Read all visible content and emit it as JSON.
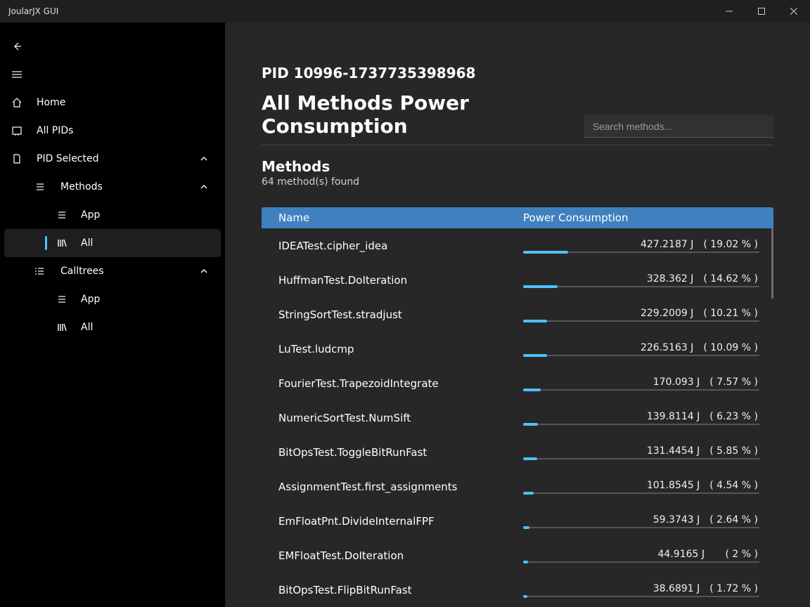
{
  "window": {
    "title": "JoularJX GUI"
  },
  "sidebar": {
    "home": "Home",
    "all_pids": "All PIDs",
    "pid_selected": "PID Selected",
    "methods": "Methods",
    "methods_app": "App",
    "methods_all": "All",
    "calltrees": "Calltrees",
    "calltrees_app": "App",
    "calltrees_all": "All"
  },
  "main": {
    "pid_title": "PID 10996-1737735398968",
    "page_title": "All Methods Power Consumption",
    "search_placeholder": "Search methods...",
    "methods_header": "Methods",
    "methods_found": "64 method(s) found",
    "col_name": "Name",
    "col_power": "Power Consumption"
  },
  "rows": [
    {
      "name": "IDEATest.cipher_idea",
      "joules": "427.2187 J",
      "pct": "( 19.02 % )",
      "bar": 19.02
    },
    {
      "name": "HuffmanTest.DoIteration",
      "joules": "328.362 J",
      "pct": "( 14.62 % )",
      "bar": 14.62
    },
    {
      "name": "StringSortTest.stradjust",
      "joules": "229.2009 J",
      "pct": "( 10.21 % )",
      "bar": 10.21
    },
    {
      "name": "LuTest.ludcmp",
      "joules": "226.5163 J",
      "pct": "( 10.09 % )",
      "bar": 10.09
    },
    {
      "name": "FourierTest.TrapezoidIntegrate",
      "joules": "170.093 J",
      "pct": "( 7.57 % )",
      "bar": 7.57
    },
    {
      "name": "NumericSortTest.NumSift",
      "joules": "139.8114 J",
      "pct": "( 6.23 % )",
      "bar": 6.23
    },
    {
      "name": "BitOpsTest.ToggleBitRunFast",
      "joules": "131.4454 J",
      "pct": "( 5.85 % )",
      "bar": 5.85
    },
    {
      "name": "AssignmentTest.first_assignments",
      "joules": "101.8545 J",
      "pct": "( 4.54 % )",
      "bar": 4.54
    },
    {
      "name": "EmFloatPnt.DivideInternalFPF",
      "joules": "59.3743 J",
      "pct": "( 2.64 % )",
      "bar": 2.64
    },
    {
      "name": "EMFloatTest.DoIteration",
      "joules": "44.9165 J",
      "pct": "( 2 % )",
      "bar": 2.0
    },
    {
      "name": "BitOpsTest.FlipBitRunFast",
      "joules": "38.6891 J",
      "pct": "( 1.72 % )",
      "bar": 1.72
    }
  ]
}
